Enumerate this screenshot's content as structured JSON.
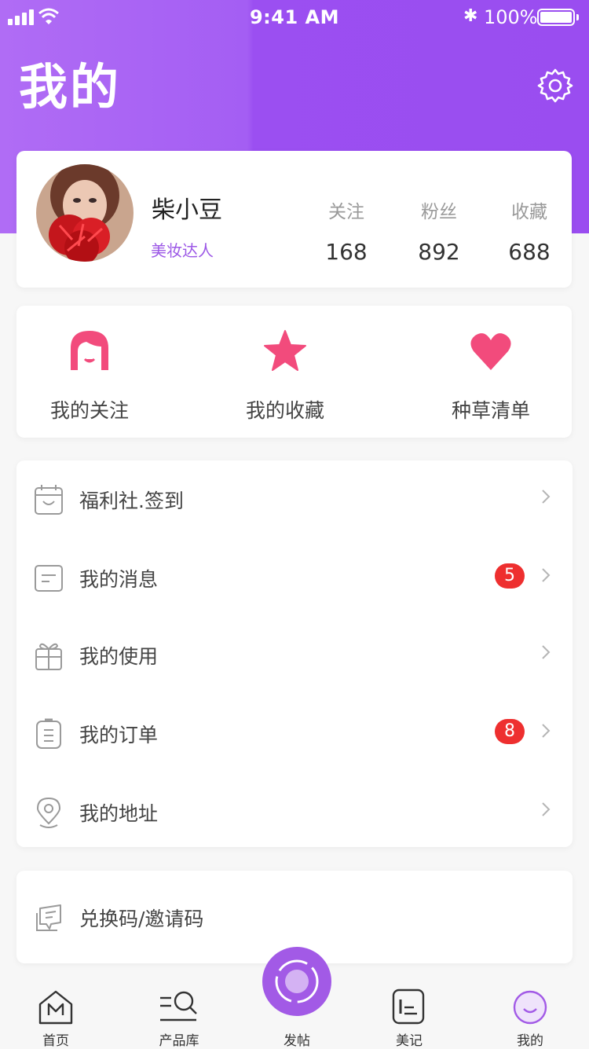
{
  "status_bar": {
    "time": "9:41 AM",
    "battery": "100%",
    "bluetooth_glyph": "✱"
  },
  "header": {
    "title": "我的",
    "settings_icon": "gear-icon"
  },
  "profile": {
    "name": "柴小豆",
    "tag": "美妆达人",
    "stats": [
      {
        "label": "关注",
        "value": "168"
      },
      {
        "label": "粉丝",
        "value": "892"
      },
      {
        "label": "收藏",
        "value": "688"
      }
    ]
  },
  "quick_links": [
    {
      "label": "我的关注",
      "icon": "girl-face-icon"
    },
    {
      "label": "我的收藏",
      "icon": "star-icon"
    },
    {
      "label": "种草清单",
      "icon": "heart-icon"
    }
  ],
  "menu": [
    {
      "label": "福利社.签到",
      "icon": "calendar-icon",
      "badge": ""
    },
    {
      "label": "我的消息",
      "icon": "message-icon",
      "badge": "5"
    },
    {
      "label": "我的使用",
      "icon": "gift-icon",
      "badge": ""
    },
    {
      "label": "我的订单",
      "icon": "clipboard-icon",
      "badge": "8"
    },
    {
      "label": "我的地址",
      "icon": "location-pin-icon",
      "badge": ""
    }
  ],
  "redeem": {
    "label": "兑换码/邀请码",
    "icon": "ticket-icon"
  },
  "tabbar": [
    {
      "label": "首页",
      "icon": "home-icon"
    },
    {
      "label": "产品库",
      "icon": "product-search-icon"
    },
    {
      "label": "发帖",
      "icon": "post-icon"
    },
    {
      "label": "美记",
      "icon": "notes-icon"
    },
    {
      "label": "我的",
      "icon": "profile-icon"
    }
  ],
  "colors": {
    "accent": "#9b4ff1",
    "pink": "#f24b7c",
    "badge": "#ee2f2f",
    "tag": "#9c58e6"
  }
}
